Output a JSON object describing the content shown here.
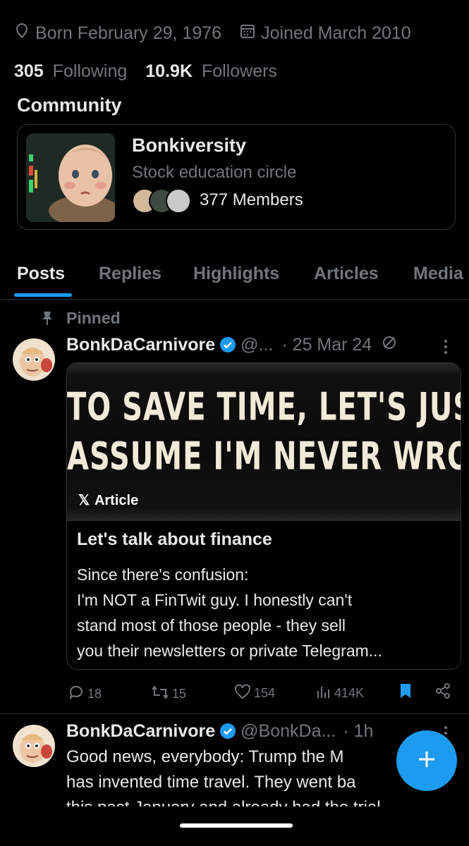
{
  "profile": {
    "born": "Born February 29, 1976",
    "joined": "Joined March 2010",
    "following_count": "305",
    "following_label": "Following",
    "followers_count": "10.9K",
    "followers_label": "Followers"
  },
  "community": {
    "section_title": "Community",
    "name": "Bonkiversity",
    "description": "Stock education circle",
    "members": "377 Members"
  },
  "tabs": [
    {
      "label": "Posts",
      "active": true
    },
    {
      "label": "Replies"
    },
    {
      "label": "Highlights"
    },
    {
      "label": "Articles"
    },
    {
      "label": "Media"
    }
  ],
  "pinned_post": {
    "pinned_label": "Pinned",
    "display_name": "BonkDaCarnivore",
    "handle": "@...",
    "time": "· 25 Mar 24",
    "article": {
      "image_text_line1": "TO SAVE TIME, LET'S JUST",
      "image_text_line2": "ASSUME I'M NEVER WRONG.",
      "badge": "Article",
      "title": "Let's talk about finance",
      "body_line1": "Since there's confusion:",
      "body_line2": "I'm NOT a FinTwit guy.  I honestly can't",
      "body_line3": "stand most of those people - they sell",
      "body_line4": "you their newsletters or private Telegram..."
    },
    "stats": {
      "replies": "18",
      "reposts": "15",
      "likes": "154",
      "views": "414K"
    }
  },
  "second_post": {
    "display_name": "BonkDaCarnivore",
    "handle": "@BonkDa...",
    "time": "· 1h",
    "line1": "Good news, everybody:  Trump the M",
    "line2": "has invented time travel.  They went ba",
    "line3": "this past January and already had the trial"
  },
  "colors": {
    "accent": "#1d9bf0",
    "muted": "#71767b",
    "border": "#2f3336",
    "background": "#000000",
    "text": "#e7e9ea"
  }
}
